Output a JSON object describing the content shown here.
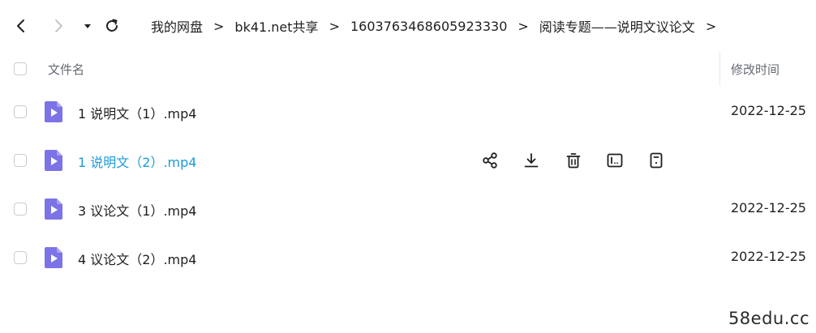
{
  "nav": {
    "back_icon": "chevron-left-icon",
    "forward_icon": "chevron-right-icon",
    "history_icon": "caret-down-icon",
    "refresh_icon": "refresh-icon"
  },
  "breadcrumb": [
    "我的网盘",
    "bk41.net共享",
    "1603763468605923330",
    "阅读专题——说明文议论文"
  ],
  "breadcrumb_separator": ">",
  "list_header": {
    "name": "文件名",
    "modified": "修改时间"
  },
  "files": [
    {
      "name": "1 说明文（1）.mp4",
      "modified": "2022-12-25"
    },
    {
      "name": "1 说明文（2）.mp4",
      "modified": ""
    },
    {
      "name": "3 议论文（1）.mp4",
      "modified": "2022-12-25"
    },
    {
      "name": "4 议论文（2）.mp4",
      "modified": "2022-12-25"
    }
  ],
  "hovered_row": 1,
  "row_actions": [
    "share-icon",
    "download-icon",
    "delete-icon",
    "rename-icon",
    "more-icon"
  ],
  "colors": {
    "hover_link": "#1a9bd8",
    "video_icon": "#7b73e6",
    "text": "#1f1f1f",
    "muted": "#646a73"
  },
  "watermark": "58edu.cc"
}
